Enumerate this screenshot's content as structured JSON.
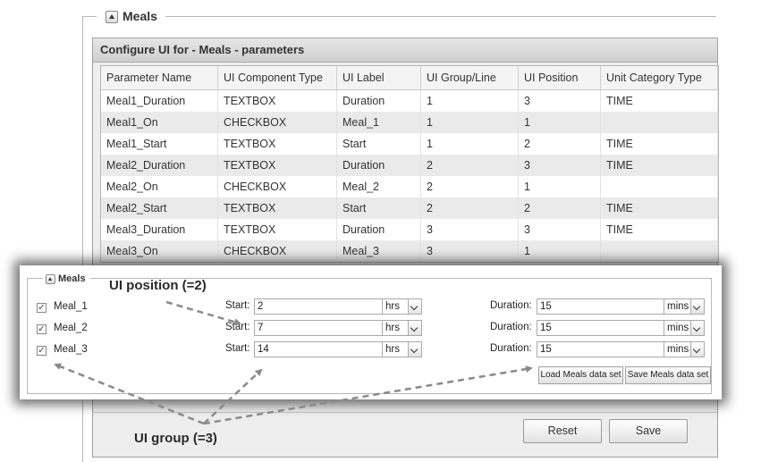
{
  "section": {
    "title": "Meals"
  },
  "panel": {
    "title": "Configure UI for - Meals - parameters"
  },
  "table": {
    "headers": [
      "Parameter Name",
      "UI Component Type",
      "UI Label",
      "UI Group/Line",
      "UI Position",
      "Unit Category Type"
    ],
    "rows": [
      [
        "Meal1_Duration",
        "TEXTBOX",
        "Duration",
        "1",
        "3",
        "TIME"
      ],
      [
        "Meal1_On",
        "CHECKBOX",
        "Meal_1",
        "1",
        "1",
        ""
      ],
      [
        "Meal1_Start",
        "TEXTBOX",
        "Start",
        "1",
        "2",
        "TIME"
      ],
      [
        "Meal2_Duration",
        "TEXTBOX",
        "Duration",
        "2",
        "3",
        "TIME"
      ],
      [
        "Meal2_On",
        "CHECKBOX",
        "Meal_2",
        "2",
        "1",
        ""
      ],
      [
        "Meal2_Start",
        "TEXTBOX",
        "Start",
        "2",
        "2",
        "TIME"
      ],
      [
        "Meal3_Duration",
        "TEXTBOX",
        "Duration",
        "3",
        "3",
        "TIME"
      ],
      [
        "Meal3_On",
        "CHECKBOX",
        "Meal_3",
        "3",
        "1",
        ""
      ]
    ]
  },
  "buttons": {
    "reset": "Reset",
    "save": "Save"
  },
  "preview": {
    "legend": "Meals",
    "rows": [
      {
        "meal": "Meal_1",
        "start_label": "Start:",
        "start": "2",
        "start_unit": "hrs",
        "duration_label": "Duration:",
        "duration": "15",
        "duration_unit": "mins"
      },
      {
        "meal": "Meal_2",
        "start_label": "Start:",
        "start": "7",
        "start_unit": "hrs",
        "duration_label": "Duration:",
        "duration": "15",
        "duration_unit": "mins"
      },
      {
        "meal": "Meal_3",
        "start_label": "Start:",
        "start": "14",
        "start_unit": "hrs",
        "duration_label": "Duration:",
        "duration": "15",
        "duration_unit": "mins"
      }
    ],
    "load_button": "Load Meals data set",
    "save_button": "Save Meals data set"
  },
  "annotations": {
    "position": "UI position (=2)",
    "group": "UI group (=3)"
  },
  "icons": {
    "collapse": "collapse-up-icon",
    "dropdown": "chevron-down-icon",
    "check": "checkmark-icon"
  }
}
